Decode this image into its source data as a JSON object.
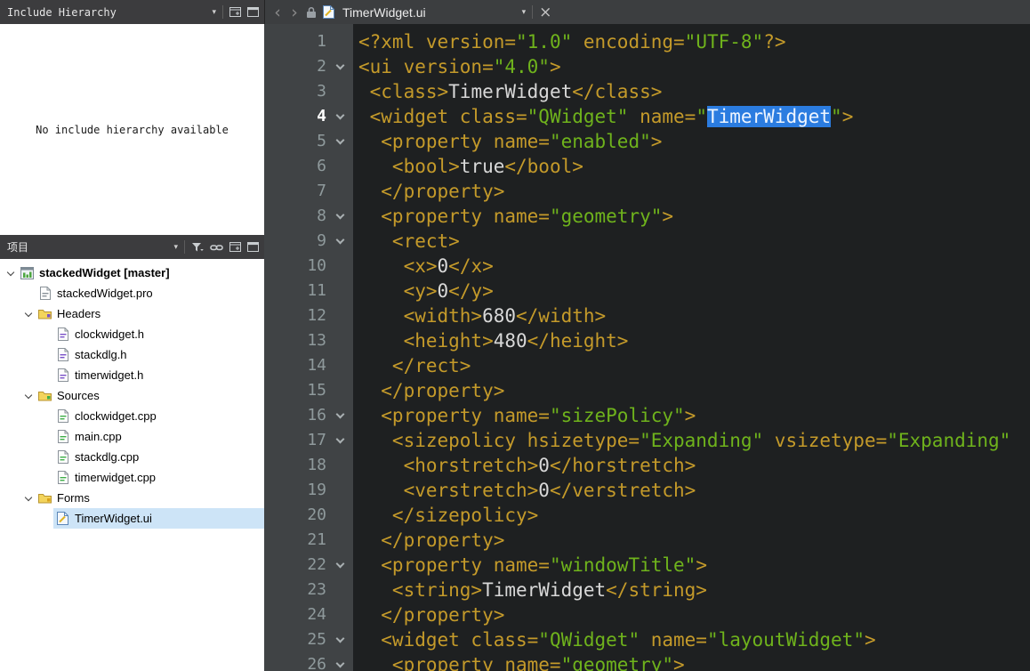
{
  "colors": {
    "panel_header_bg": "#3c3c3e",
    "panel_header_fg": "#e6e6e6",
    "tabbar_bg": "#3c3e40",
    "editor_bg": "#1e2021",
    "gutter_bg": "#404345",
    "line_number": "#8f9a9c",
    "tag": "#c49a2a",
    "string": "#6fb31c",
    "plain": "#d8d8d8",
    "selection_bg": "#2b7ce0",
    "selection_fg": "#eef5ff",
    "tree_selected_bg": "#cde4f7"
  },
  "include_hierarchy": {
    "title": "Include Hierarchy",
    "empty_message": "No include hierarchy available"
  },
  "projects": {
    "title": "项目",
    "tree": [
      {
        "depth": 0,
        "label": "stackedWidget [master]",
        "icon": "project",
        "bold": true,
        "expanded": true
      },
      {
        "depth": 1,
        "label": "stackedWidget.pro",
        "icon": "pro-file"
      },
      {
        "depth": 1,
        "label": "Headers",
        "icon": "headers-folder",
        "expanded": true
      },
      {
        "depth": 2,
        "label": "clockwidget.h",
        "icon": "header-file"
      },
      {
        "depth": 2,
        "label": "stackdlg.h",
        "icon": "header-file"
      },
      {
        "depth": 2,
        "label": "timerwidget.h",
        "icon": "header-file"
      },
      {
        "depth": 1,
        "label": "Sources",
        "icon": "sources-folder",
        "expanded": true
      },
      {
        "depth": 2,
        "label": "clockwidget.cpp",
        "icon": "source-file"
      },
      {
        "depth": 2,
        "label": "main.cpp",
        "icon": "source-file"
      },
      {
        "depth": 2,
        "label": "stackdlg.cpp",
        "icon": "source-file"
      },
      {
        "depth": 2,
        "label": "timerwidget.cpp",
        "icon": "source-file"
      },
      {
        "depth": 1,
        "label": "Forms",
        "icon": "forms-folder",
        "expanded": true
      },
      {
        "depth": 2,
        "label": "TimerWidget.ui",
        "icon": "ui-file",
        "selected": true
      }
    ]
  },
  "editor": {
    "tab_title": "TimerWidget.ui",
    "lines": [
      {
        "n": 1,
        "fold": false,
        "seg": [
          [
            "g",
            "<?xml version="
          ],
          [
            "s",
            "\"1.0\""
          ],
          [
            "g",
            " encoding="
          ],
          [
            "s",
            "\"UTF-8\""
          ],
          [
            "g",
            "?>"
          ]
        ]
      },
      {
        "n": 2,
        "fold": true,
        "seg": [
          [
            "g",
            "<ui version="
          ],
          [
            "s",
            "\"4.0\""
          ],
          [
            "g",
            ">"
          ]
        ]
      },
      {
        "n": 3,
        "fold": false,
        "seg": [
          [
            "g",
            " <class>"
          ],
          [
            "t",
            "TimerWidget"
          ],
          [
            "g",
            "</class>"
          ]
        ]
      },
      {
        "n": 4,
        "fold": true,
        "current": true,
        "seg": [
          [
            "g",
            " <widget class="
          ],
          [
            "s",
            "\"QWidget\""
          ],
          [
            "g",
            " name="
          ],
          [
            "s",
            "\""
          ],
          [
            "sel",
            "TimerWidget"
          ],
          [
            "s",
            "\""
          ],
          [
            "g",
            ">"
          ]
        ]
      },
      {
        "n": 5,
        "fold": true,
        "seg": [
          [
            "g",
            "  <property name="
          ],
          [
            "s",
            "\"enabled\""
          ],
          [
            "g",
            ">"
          ]
        ]
      },
      {
        "n": 6,
        "fold": false,
        "seg": [
          [
            "g",
            "   <bool>"
          ],
          [
            "t",
            "true"
          ],
          [
            "g",
            "</bool>"
          ]
        ]
      },
      {
        "n": 7,
        "fold": false,
        "seg": [
          [
            "g",
            "  </property>"
          ]
        ]
      },
      {
        "n": 8,
        "fold": true,
        "seg": [
          [
            "g",
            "  <property name="
          ],
          [
            "s",
            "\"geometry\""
          ],
          [
            "g",
            ">"
          ]
        ]
      },
      {
        "n": 9,
        "fold": true,
        "seg": [
          [
            "g",
            "   <rect>"
          ]
        ]
      },
      {
        "n": 10,
        "fold": false,
        "seg": [
          [
            "g",
            "    <x>"
          ],
          [
            "t",
            "0"
          ],
          [
            "g",
            "</x>"
          ]
        ]
      },
      {
        "n": 11,
        "fold": false,
        "seg": [
          [
            "g",
            "    <y>"
          ],
          [
            "t",
            "0"
          ],
          [
            "g",
            "</y>"
          ]
        ]
      },
      {
        "n": 12,
        "fold": false,
        "seg": [
          [
            "g",
            "    <width>"
          ],
          [
            "t",
            "680"
          ],
          [
            "g",
            "</width>"
          ]
        ]
      },
      {
        "n": 13,
        "fold": false,
        "seg": [
          [
            "g",
            "    <height>"
          ],
          [
            "t",
            "480"
          ],
          [
            "g",
            "</height>"
          ]
        ]
      },
      {
        "n": 14,
        "fold": false,
        "seg": [
          [
            "g",
            "   </rect>"
          ]
        ]
      },
      {
        "n": 15,
        "fold": false,
        "seg": [
          [
            "g",
            "  </property>"
          ]
        ]
      },
      {
        "n": 16,
        "fold": true,
        "seg": [
          [
            "g",
            "  <property name="
          ],
          [
            "s",
            "\"sizePolicy\""
          ],
          [
            "g",
            ">"
          ]
        ]
      },
      {
        "n": 17,
        "fold": true,
        "seg": [
          [
            "g",
            "   <sizepolicy hsizetype="
          ],
          [
            "s",
            "\"Expanding\""
          ],
          [
            "g",
            " vsizetype="
          ],
          [
            "s",
            "\"Expanding\""
          ]
        ]
      },
      {
        "n": 18,
        "fold": false,
        "seg": [
          [
            "g",
            "    <horstretch>"
          ],
          [
            "t",
            "0"
          ],
          [
            "g",
            "</horstretch>"
          ]
        ]
      },
      {
        "n": 19,
        "fold": false,
        "seg": [
          [
            "g",
            "    <verstretch>"
          ],
          [
            "t",
            "0"
          ],
          [
            "g",
            "</verstretch>"
          ]
        ]
      },
      {
        "n": 20,
        "fold": false,
        "seg": [
          [
            "g",
            "   </sizepolicy>"
          ]
        ]
      },
      {
        "n": 21,
        "fold": false,
        "seg": [
          [
            "g",
            "  </property>"
          ]
        ]
      },
      {
        "n": 22,
        "fold": true,
        "seg": [
          [
            "g",
            "  <property name="
          ],
          [
            "s",
            "\"windowTitle\""
          ],
          [
            "g",
            ">"
          ]
        ]
      },
      {
        "n": 23,
        "fold": false,
        "seg": [
          [
            "g",
            "   <string>"
          ],
          [
            "t",
            "TimerWidget"
          ],
          [
            "g",
            "</string>"
          ]
        ]
      },
      {
        "n": 24,
        "fold": false,
        "seg": [
          [
            "g",
            "  </property>"
          ]
        ]
      },
      {
        "n": 25,
        "fold": true,
        "seg": [
          [
            "g",
            "  <widget class="
          ],
          [
            "s",
            "\"QWidget\""
          ],
          [
            "g",
            " name="
          ],
          [
            "s",
            "\"layoutWidget\""
          ],
          [
            "g",
            ">"
          ]
        ]
      },
      {
        "n": 26,
        "fold": true,
        "seg": [
          [
            "g",
            "   <property name="
          ],
          [
            "s",
            "\"geometry\""
          ],
          [
            "g",
            ">"
          ]
        ]
      }
    ]
  }
}
